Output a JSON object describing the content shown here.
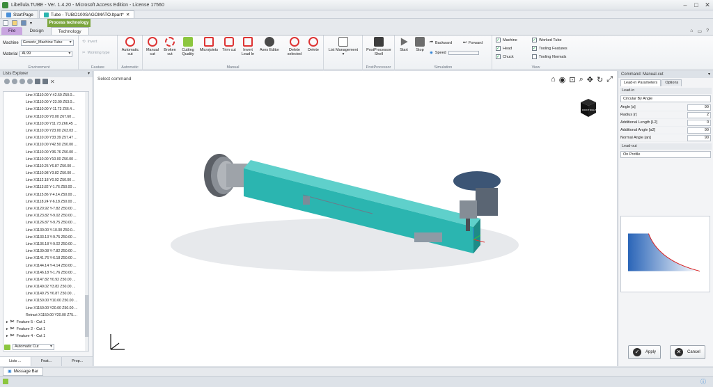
{
  "window": {
    "title": "Libellula.TUBE - Ver. 1.4.20 - Microsoft Access Edition - License 17560"
  },
  "doc_tabs": [
    "StartPage",
    "Tube - TUBO100SAGOMATO.ltpart*"
  ],
  "ribbon": {
    "context_label": "Process technology",
    "tabs": [
      "File",
      "Design",
      "Technology"
    ],
    "environment": {
      "machine_label": "Machine",
      "machine_value": "Generic_Machine Tube",
      "material_label": "Material",
      "material_value": "AL99",
      "label": "Environment"
    },
    "feature": {
      "invert": "Invert",
      "working_type": "Working type",
      "label": "Feature"
    },
    "automatic": {
      "automatic_cut": "Automatic cut",
      "label": "Automatic"
    },
    "manual": {
      "buttons": [
        "Manual cut",
        "Broken cut",
        "Cutting Quality",
        "Microjoints",
        "Trim cut",
        "Invert Lead In",
        "Axes Editor",
        "Delete selected",
        "Delete"
      ],
      "label": "Manual"
    },
    "list": {
      "list_management": "List Management"
    },
    "postprocessor": {
      "shell": "PostProcessor Shell",
      "label": "PostProcessor"
    },
    "simulation": {
      "start": "Start",
      "stop": "Stop",
      "backward": "Backward",
      "forward": "Forward",
      "speed": "Speed",
      "label": "Simulation"
    },
    "view": {
      "items": [
        "Machine",
        "Head",
        "Chuck"
      ],
      "items2": [
        "Worked Tube",
        "Tooling Features",
        "Tooling Normals"
      ],
      "label": "View"
    }
  },
  "lists_explorer": {
    "title": "Lists Explorer",
    "lines": [
      "Line X1110.00 Y-42.50 Z50.0...",
      "Line X1110.00 Y-23.00 Z63.0...",
      "Line X1110.00 Y-11.73 Z66.4...",
      "Line X1110.00 Y0.00 Z67.60 ...",
      "Line X1110.00 Y11.73 Z66.45 ...",
      "Line X1110.00 Y23.00 Z63.03 ...",
      "Line X1110.00 Y33.39 Z57.47 ...",
      "Line X1110.00 Y42.50 Z50.00 ...",
      "Line X1110.00 Y36.76 Z50.00 ...",
      "Line X1110.00 Y10.00 Z50.00 ...",
      "Line X1110.25 Y6.87 Z50.00 ...",
      "Line X1110.98 Y3.82 Z50.00 ...",
      "Line X1112.18 Y0.92 Z50.00 ...",
      "Line X1113.82 Y-1.76 Z50.00 ...",
      "Line X1115.86 Y-4.14 Z50.00 ...",
      "Line X1118.24 Y-6.18 Z50.00 ...",
      "Line X1120.92 Y-7.82 Z50.00 ...",
      "Line X1123.82 Y-9.02 Z50.00 ...",
      "Line X1126.87 Y-9.75 Z50.00 ...",
      "Line X1130.00 Y-10.00 Z50.0...",
      "Line X1133.13 Y-9.75 Z50.00 ...",
      "Line X1136.18 Y-9.02 Z50.00 ...",
      "Line X1139.08 Y-7.82 Z50.00 ...",
      "Line X1141.76 Y-6.18 Z50.00 ...",
      "Line X1144.14 Y-4.14 Z50.00 ...",
      "Line X1146.18 Y-1.76 Z50.00 ...",
      "Line X1147.82 Y0.92 Z50.00 ...",
      "Line X1149.02 Y3.82 Z50.00 ...",
      "Line X1149.75 Y6.87 Z50.00 ...",
      "Line X1150.00 Y10.00 Z50.00 ...",
      "Line X1150.00 Y20.00 Z50.00 ...",
      "Retract X1150.00 Y20.00 Z75...."
    ],
    "features": [
      "Feature 5 - Cut 1",
      "Feature 2 - Cut 1",
      "Feature 4 - Cut 1"
    ],
    "auto_cut": "Automatic Cut",
    "tabs": [
      "Lists ...",
      "Feat...",
      "Prop..."
    ]
  },
  "viewport": {
    "status": "Select command",
    "cube_front": "FRONT",
    "cube_right": "RIGHT"
  },
  "command_panel": {
    "title": "Command: Manual-cut",
    "tabs": [
      "Lead-in Parameters",
      "Options"
    ],
    "leadin_label": "Lead-in",
    "leadin_type": "Circular By Angle",
    "params": [
      {
        "label": "Angle [a]",
        "value": "90"
      },
      {
        "label": "Radius [r]",
        "value": "2"
      },
      {
        "label": "Additional Length [L2]",
        "value": "0"
      },
      {
        "label": "Additional Angle [a2]",
        "value": "90"
      },
      {
        "label": "Normal Angle [an]",
        "value": "90"
      }
    ],
    "leadout_label": "Lead-out",
    "leadout_type": "On Profile",
    "apply": "Apply",
    "cancel": "Cancel"
  },
  "message_bar": "Message Bar",
  "colors": {
    "tube": "#2bb5b0",
    "accent": "#7ca63f",
    "file_tab": "#c9a6e0"
  }
}
